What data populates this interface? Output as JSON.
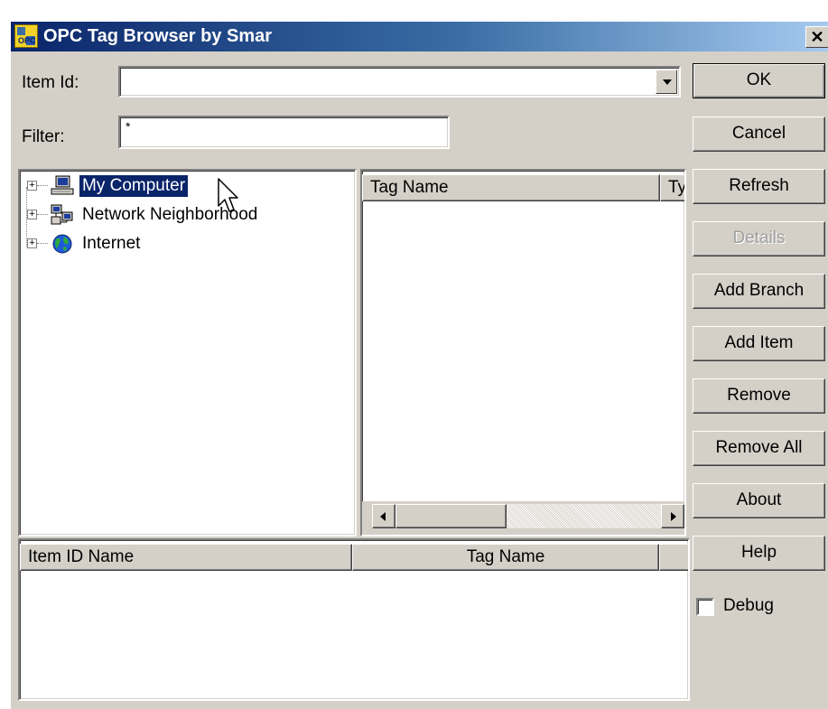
{
  "window": {
    "title": "OPC Tag Browser by Smar",
    "close_glyph": "✕"
  },
  "item_id": {
    "label": "Item Id:",
    "value": ""
  },
  "filter": {
    "label": "Filter:",
    "value": "*"
  },
  "tree": {
    "items": [
      {
        "label": "My Computer",
        "icon": "computer-icon",
        "selected": true
      },
      {
        "label": "Network Neighborhood",
        "icon": "network-icon",
        "selected": false
      },
      {
        "label": "Internet",
        "icon": "globe-icon",
        "selected": false
      }
    ],
    "expander_glyph": "+"
  },
  "tag_list": {
    "columns": [
      "Tag Name",
      "Ty"
    ]
  },
  "item_list": {
    "columns": [
      "Item ID Name",
      "Tag Name",
      ""
    ]
  },
  "buttons": {
    "ok": "OK",
    "cancel": "Cancel",
    "refresh": "Refresh",
    "details": "Details",
    "add_branch": "Add Branch",
    "add_item": "Add Item",
    "remove": "Remove",
    "remove_all": "Remove All",
    "about": "About",
    "help": "Help"
  },
  "debug": {
    "label": "Debug",
    "checked": false
  },
  "colors": {
    "title_start": "#0a246a",
    "title_end": "#a6caf0",
    "face": "#d4d0c8",
    "selection": "#0a246a"
  }
}
